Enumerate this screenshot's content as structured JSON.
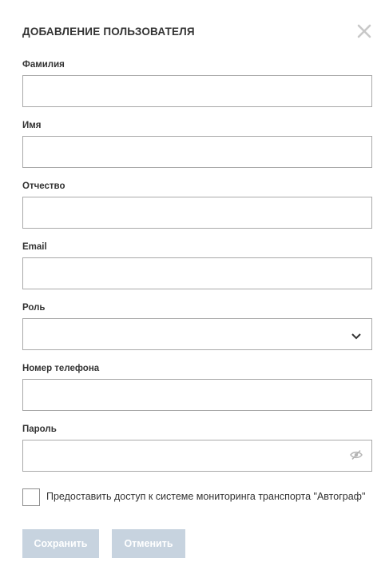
{
  "dialog": {
    "title": "ДОБАВЛЕНИЕ ПОЛЬЗОВАТЕЛЯ",
    "close_icon": "close-icon"
  },
  "fields": {
    "last_name": {
      "label": "Фамилия",
      "value": ""
    },
    "first_name": {
      "label": "Имя",
      "value": ""
    },
    "patronymic": {
      "label": "Отчество",
      "value": ""
    },
    "email": {
      "label": "Email",
      "value": ""
    },
    "role": {
      "label": "Роль",
      "value": "",
      "icon": "chevron-down-icon"
    },
    "phone": {
      "label": "Номер телефона",
      "value": ""
    },
    "password": {
      "label": "Пароль",
      "value": "",
      "icon": "eye-off-icon"
    }
  },
  "access_checkbox": {
    "label": "Предоставить доступ к системе мониторинга транспорта \"Автограф\"",
    "checked": false
  },
  "buttons": {
    "save_label": "Сохранить",
    "cancel_label": "Отменить"
  },
  "colors": {
    "button_disabled_bg": "#c7d3df",
    "border": "#a9a9a9",
    "text": "#333333"
  }
}
